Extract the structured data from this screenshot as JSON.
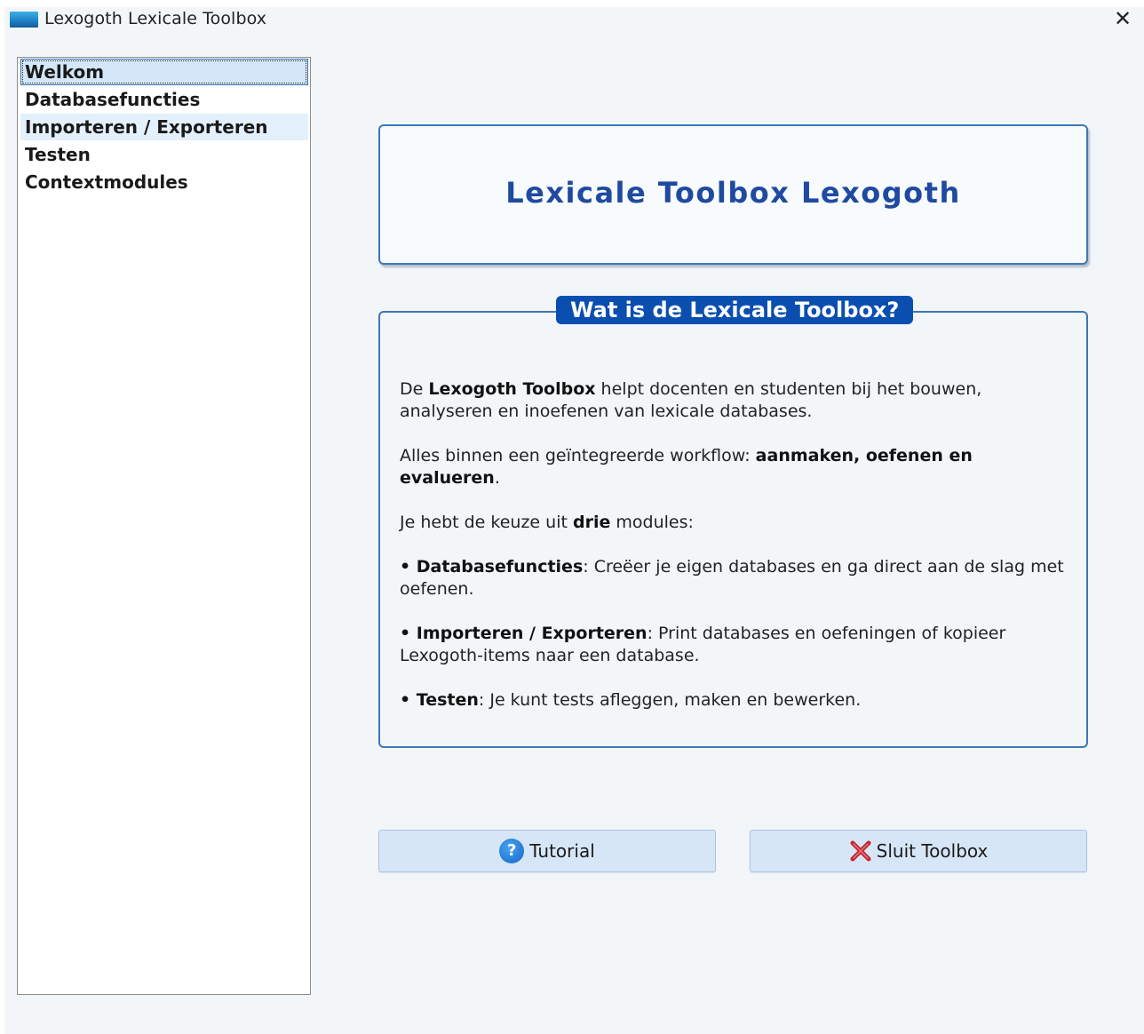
{
  "window": {
    "title": "Lexogoth Lexicale Toolbox",
    "close_glyph": "✕"
  },
  "sidebar": {
    "items": [
      {
        "label": "Welkom",
        "state": "selected"
      },
      {
        "label": "Databasefuncties",
        "state": "normal"
      },
      {
        "label": "Importeren / Exporteren",
        "state": "hover"
      },
      {
        "label": "Testen",
        "state": "normal"
      },
      {
        "label": "Contextmodules",
        "state": "normal"
      }
    ]
  },
  "header": {
    "title": "Lexicale Toolbox Lexogoth"
  },
  "info": {
    "heading": "Wat is de Lexicale Toolbox?",
    "p1": {
      "pre": "De ",
      "bold": "Lexogoth Toolbox",
      "post": " helpt docenten en studenten bij het bouwen, analyseren en inoefenen van lexicale databases."
    },
    "p2": {
      "pre": "Alles binnen een geïntegreerde workflow: ",
      "bold": "aanmaken, oefenen en evalueren",
      "post": "."
    },
    "p3": {
      "pre": "Je hebt de keuze uit ",
      "bold": "drie",
      "post": " modules:"
    },
    "bullet_glyph": "• ",
    "modules": [
      {
        "name": "Databasefuncties",
        "desc": ": Creëer je eigen databases en ga direct aan de slag met oefenen."
      },
      {
        "name": "Importeren / Exporteren",
        "desc": ": Print databases en oefeningen of kopieer Lexogoth-items naar een database."
      },
      {
        "name": "Testen",
        "desc": ": Je kunt tests afleggen, maken en bewerken."
      }
    ]
  },
  "buttons": {
    "tutorial_label": "Tutorial",
    "tutorial_icon": "help-icon",
    "help_glyph": "?",
    "close_label": "Sluit Toolbox",
    "close_icon": "red-x-icon"
  },
  "colors": {
    "accent": "#0a4fb0",
    "title_text": "#1f4aa0",
    "panel_border": "#3b78b8",
    "button_bg": "#d6e6f7",
    "selected_bg": "#d4e7f8"
  }
}
